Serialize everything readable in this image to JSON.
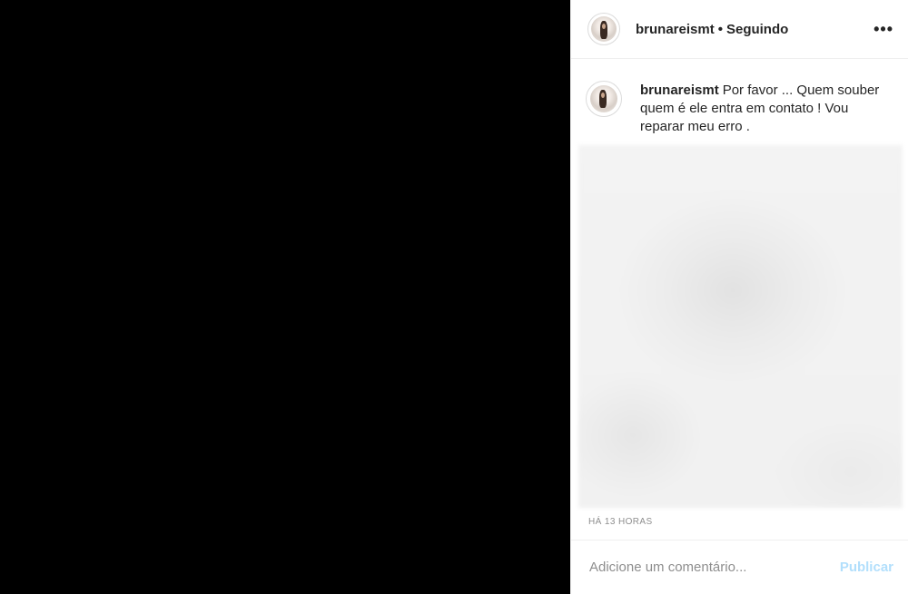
{
  "post": {
    "username": "brunareismt",
    "separator": "•",
    "follow_status": "Seguindo",
    "more_label": "•••",
    "caption_user": "brunareismt",
    "caption_text": "Por favor ... Quem souber quem é ele entra em contato ! Vou reparar meu erro .",
    "timestamp": "HÁ 13 HORAS"
  },
  "comment": {
    "placeholder": "Adicione um comentário...",
    "publish_label": "Publicar"
  },
  "colors": {
    "publish_disabled": "#b2dffc",
    "muted_text": "#8e8e8e",
    "text": "#262626"
  }
}
